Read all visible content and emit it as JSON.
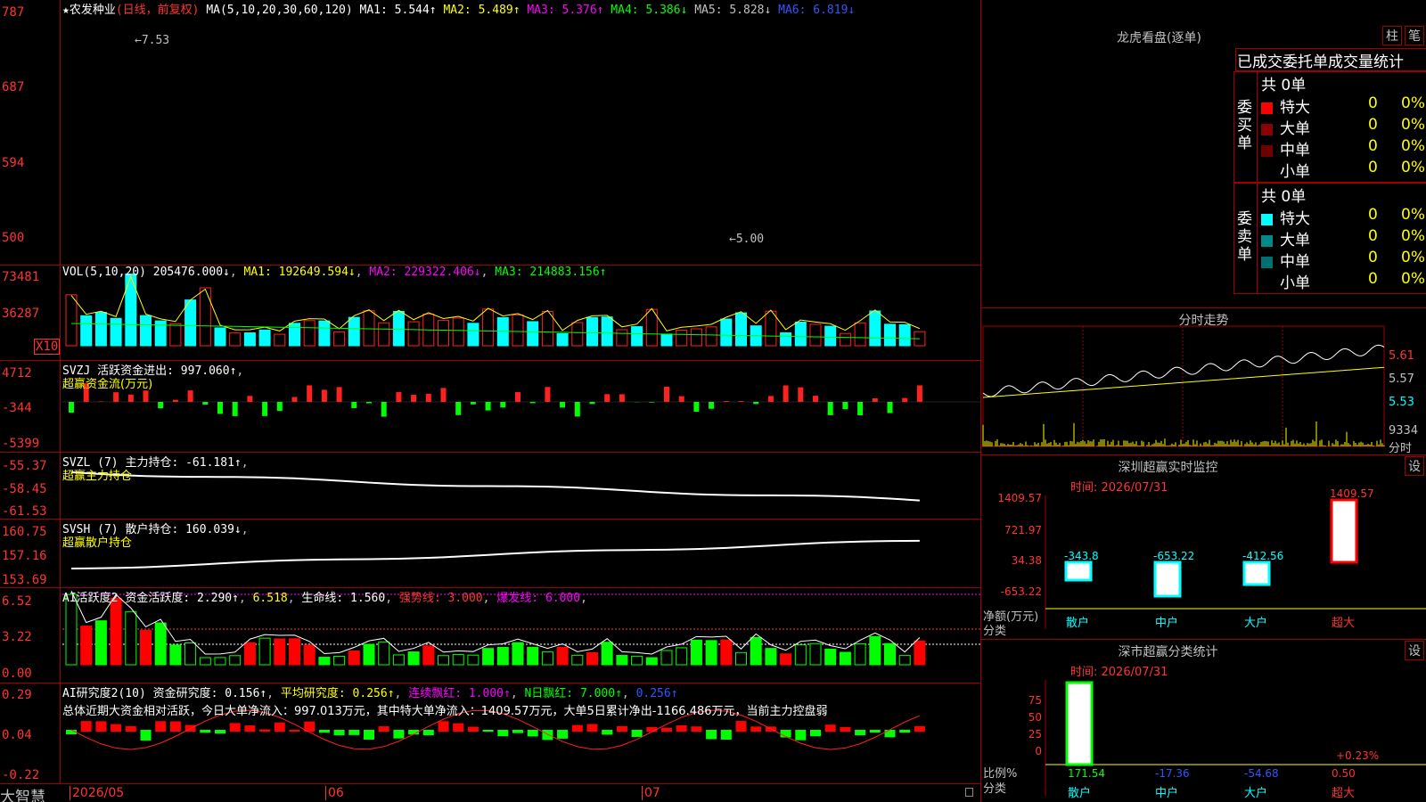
{
  "app": {
    "brand": "大智慧"
  },
  "main": {
    "stock_name": "农发种业",
    "period": "(日线，前复权)",
    "ma_header": "MA(5,10,20,30,60,120)",
    "ma1": "MA1: 5.544↑",
    "ma2": "MA2: 5.489↑",
    "ma3": "MA3: 5.376↑",
    "ma4": "MA4: 5.386↓",
    "ma5": "MA5: 5.828↓",
    "ma6": "MA6: 6.819↓",
    "y_ticks": [
      "787",
      "687",
      "594",
      "500"
    ],
    "high_mark": "7.53",
    "low_mark": "5.00"
  },
  "vol": {
    "header": "VOL(5,10,20)",
    "value": "205476.000↓",
    "ma1": "MA1: 192649.594↓",
    "ma2": "MA2: 229322.406↓",
    "ma3": "MA3: 214883.156↑",
    "y_ticks": [
      "73481",
      "36287"
    ],
    "unit": "X10"
  },
  "svzj": {
    "header": "SVZJ",
    "label": "活跃资金进出: 997.060↑",
    "sub": "超赢资金流(万元)",
    "y_ticks": [
      "4712",
      "-344",
      "-5399"
    ]
  },
  "svzl": {
    "header": "SVZL (7)",
    "label": "主力持仓: -61.181↑",
    "sub": "超赢主力持仓",
    "y_ticks": [
      "-55.37",
      "-58.45",
      "-61.53"
    ]
  },
  "svsh": {
    "header": "SVSH (7)",
    "label": "散户持仓: 160.039↓",
    "sub": "超赢散户持仓",
    "y_ticks": [
      "160.75",
      "157.16",
      "153.69"
    ]
  },
  "ai1": {
    "header": "AI活跃度2",
    "l1": "资金活跃度: 2.290↑",
    "l2": "6.518",
    "l3": "生命线: 1.560",
    "l4": "强势线: 3.000",
    "l5": "爆发线: 6.000",
    "y_ticks": [
      "6.52",
      "3.22",
      "0.00"
    ]
  },
  "ai2": {
    "header": "AI研究度2(10)",
    "l1": "资金研究度: 0.156↑",
    "l2": "平均研究度: 0.256↑",
    "l3": "连续飘红: 1.000↑",
    "l4": "N日飘红: 7.000↑",
    "l5": "0.256↑",
    "summary": "总体近期大资金相对活跃，今日大单净流入：997.013万元，其中特大单净流入：1409.57万元，大单5日累计净出-1166.486万元，当前主力控盘弱",
    "y_ticks": [
      "0.29",
      "0.04",
      "-0.22"
    ]
  },
  "xaxis": {
    "labels": [
      "2026/05",
      "06",
      "07"
    ]
  },
  "lhb": {
    "title": "龙虎看盘(逐单)",
    "btn1": "柱",
    "btn2": "笔",
    "heading": "已成交委托单成交量统计",
    "buy_total": "共 0单",
    "buy_side": "委买单",
    "sell_total": "共 0单",
    "sell_side": "委卖单",
    "buy_rows": [
      {
        "name": "特大",
        "count": "0",
        "pct": "0%"
      },
      {
        "name": "大单",
        "count": "0",
        "pct": "0%"
      },
      {
        "name": "中单",
        "count": "0",
        "pct": "0%"
      },
      {
        "name": "小单",
        "count": "0",
        "pct": "0%"
      }
    ],
    "sell_rows": [
      {
        "name": "特大",
        "count": "0",
        "pct": "0%"
      },
      {
        "name": "大单",
        "count": "0",
        "pct": "0%"
      },
      {
        "name": "中单",
        "count": "0",
        "pct": "0%"
      },
      {
        "name": "小单",
        "count": "0",
        "pct": "0%"
      }
    ]
  },
  "intraday": {
    "title": "分时走势",
    "p1": "5.61",
    "p2": "5.57",
    "p3": "5.53",
    "vol": "9334",
    "unit": "分时"
  },
  "monitor": {
    "title": "深圳超赢实时监控",
    "btn": "设",
    "time": "时间: 2026/07/31",
    "y_ticks": [
      "1409.57",
      "721.97",
      "34.38",
      "-653.22"
    ],
    "ylabel1": "净额(万元)",
    "ylabel2": "分类",
    "bars": [
      {
        "cat": "散户",
        "value": "-343.8"
      },
      {
        "cat": "中户",
        "value": "-653.22"
      },
      {
        "cat": "大户",
        "value": "-412.56"
      },
      {
        "cat": "超大",
        "value": "1409.57"
      }
    ]
  },
  "classify": {
    "title": "深市超赢分类统计",
    "btn": "设",
    "time": "时间: 2026/07/31",
    "y_ticks": [
      "75",
      "50",
      "25",
      "0"
    ],
    "ylabel1": "比例%",
    "ylabel2": "分类",
    "pct_note": "+0.23%",
    "bars": [
      {
        "cat": "散户",
        "value": "171.54"
      },
      {
        "cat": "中户",
        "value": "-17.36"
      },
      {
        "cat": "大户",
        "value": "-54.68"
      },
      {
        "cat": "超大",
        "value": "0.50"
      }
    ]
  },
  "colors": {
    "up": "#ff2020",
    "down": "#00ffff",
    "axis": "#a00000",
    "green": "#00ff00"
  }
}
